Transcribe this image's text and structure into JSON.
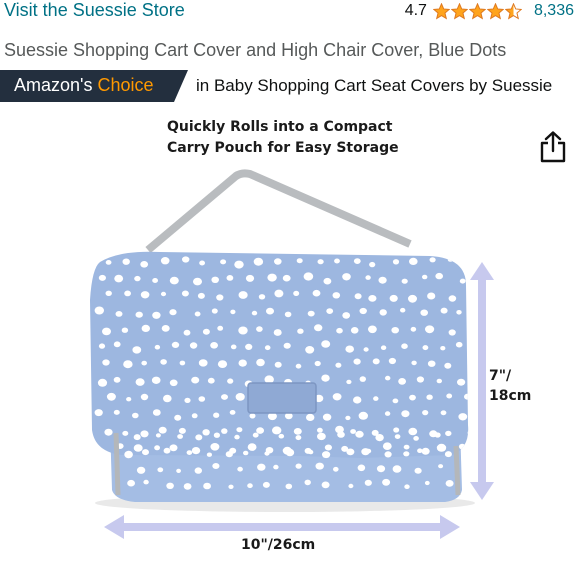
{
  "header": {
    "store_link": "Visit the Suessie Store",
    "rating_value": "4.7",
    "star_rating": 4.5,
    "rating_count": "8,336"
  },
  "product": {
    "title": "Suessie Shopping Cart Cover and High Chair Cover, Blue Dots"
  },
  "badge": {
    "label_prefix": "Amazon's",
    "label_accent": "Choice",
    "category_text": "in Baby Shopping Cart Seat Covers by Suessie"
  },
  "image": {
    "caption_line1": "Quickly Rolls into a Compact",
    "caption_line2": "Carry Pouch for Easy Storage",
    "height_dim_line1": "7\"/",
    "height_dim_line2": "18cm",
    "width_dim": "10\"/26cm"
  },
  "icons": {
    "share": "share-icon",
    "star": "star-icon"
  },
  "colors": {
    "link": "#007185",
    "star": "#ffa41c",
    "badge_bg": "#232f3e",
    "badge_accent": "#ff9900",
    "pouch": "#9db7e0",
    "arrow": "#c7c9ee"
  }
}
